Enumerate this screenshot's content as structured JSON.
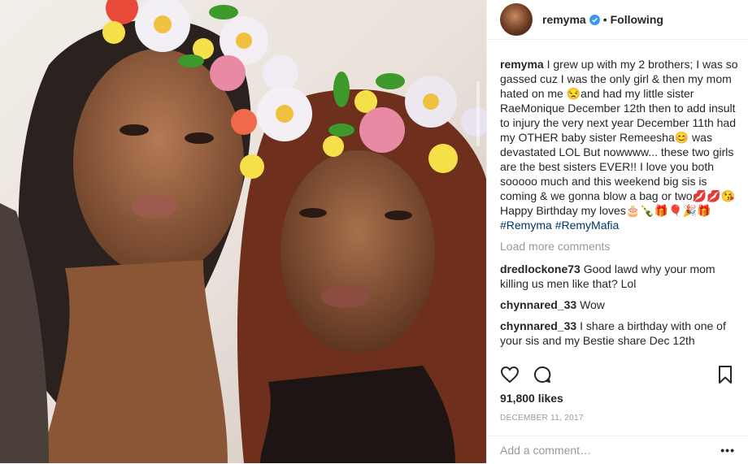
{
  "header": {
    "username": "remyma",
    "dot": "•",
    "follow_status": "Following"
  },
  "caption": {
    "username": "remyma",
    "text": "I grew up with my 2 brothers; I was so gassed cuz I was the only girl & then my mom hated on me 😒and had my little sister RaeMonique December 12th then to add insult to injury the very next year December 11th had my OTHER baby sister Remeesha😊 was devastated LOL But nowwww... these two girls are the best sisters EVER!! I love you both sooooo much and this weekend big sis is coming & we gonna blow a bag or two💋💋😘Happy Birthday my loves🎂🍾🎁🎈🎉🎁",
    "hashtag1": "#Remyma",
    "hashtag2": "#RemyMafia"
  },
  "load_more": "Load more comments",
  "comments": [
    {
      "username": "dredlockone73",
      "text": "Good lawd why your mom killing us men like that? Lol"
    },
    {
      "username": "chynnared_33",
      "text": "Wow"
    },
    {
      "username": "chynnared_33",
      "text": "I share a birthday with one of your sis and my Bestie share Dec 12th"
    }
  ],
  "likes": "91,800 likes",
  "date": "DECEMBER 11, 2017",
  "add_comment_placeholder": "Add a comment…",
  "more_options": "•••",
  "icons": {
    "like": "heart-icon",
    "comment": "comment-icon",
    "save": "bookmark-icon",
    "verified": "verified-badge-icon"
  },
  "colors": {
    "verified_blue": "#3897f0",
    "hashtag": "#003569",
    "muted": "#999999"
  }
}
